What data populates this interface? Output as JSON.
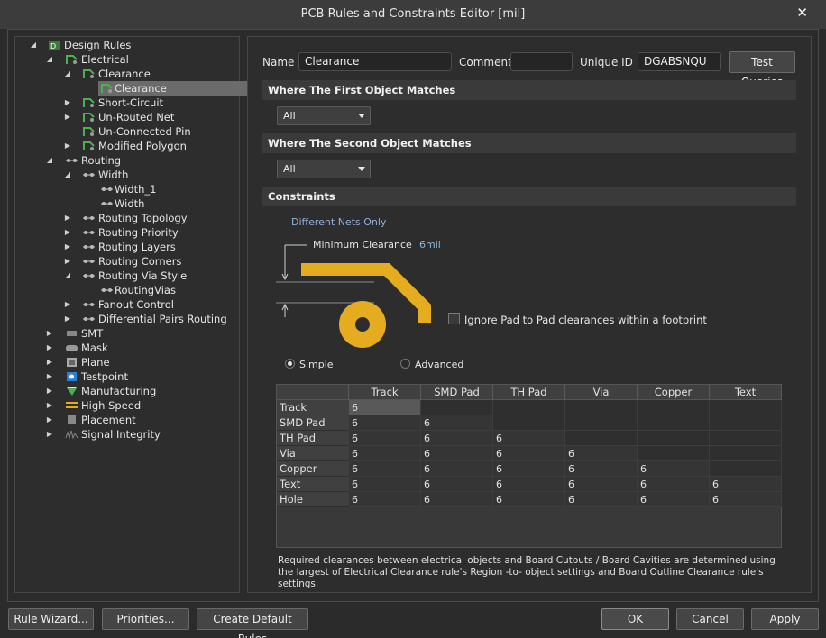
{
  "window": {
    "title": "PCB Rules and Constraints Editor [mil]"
  },
  "tree": [
    {
      "label": "Design Rules",
      "icon": "design-rules-icon",
      "arrow": "expanded",
      "level": 0
    },
    {
      "label": "Electrical",
      "icon": "electrical-icon",
      "arrow": "expanded",
      "level": 1
    },
    {
      "label": "Clearance",
      "icon": "clearance-rule-icon",
      "arrow": "expanded",
      "level": 2
    },
    {
      "label": "Clearance",
      "icon": "clearance-rule-icon",
      "arrow": "none",
      "level": 3,
      "selected": true
    },
    {
      "label": "Short-Circuit",
      "icon": "short-circuit-icon",
      "arrow": "collapsed",
      "level": 2
    },
    {
      "label": "Un-Routed Net",
      "icon": "unrouted-net-icon",
      "arrow": "collapsed",
      "level": 2
    },
    {
      "label": "Un-Connected Pin",
      "icon": "unconnected-pin-icon",
      "arrow": "none",
      "level": 2
    },
    {
      "label": "Modified Polygon",
      "icon": "modified-polygon-icon",
      "arrow": "collapsed",
      "level": 2
    },
    {
      "label": "Routing",
      "icon": "routing-icon",
      "arrow": "expanded",
      "level": 1
    },
    {
      "label": "Width",
      "icon": "width-rule-icon",
      "arrow": "expanded",
      "level": 2
    },
    {
      "label": "Width_1",
      "icon": "width-rule-icon",
      "arrow": "none",
      "level": 3
    },
    {
      "label": "Width",
      "icon": "width-rule-icon",
      "arrow": "none",
      "level": 3
    },
    {
      "label": "Routing Topology",
      "icon": "routing-topology-icon",
      "arrow": "collapsed",
      "level": 2
    },
    {
      "label": "Routing Priority",
      "icon": "routing-priority-icon",
      "arrow": "collapsed",
      "level": 2
    },
    {
      "label": "Routing Layers",
      "icon": "routing-layers-icon",
      "arrow": "collapsed",
      "level": 2
    },
    {
      "label": "Routing Corners",
      "icon": "routing-corners-icon",
      "arrow": "collapsed",
      "level": 2
    },
    {
      "label": "Routing Via Style",
      "icon": "routing-via-style-icon",
      "arrow": "expanded",
      "level": 2
    },
    {
      "label": "RoutingVias",
      "icon": "routing-via-style-icon",
      "arrow": "none",
      "level": 3
    },
    {
      "label": "Fanout Control",
      "icon": "fanout-control-icon",
      "arrow": "collapsed",
      "level": 2
    },
    {
      "label": "Differential Pairs Routing",
      "icon": "differential-pairs-icon",
      "arrow": "collapsed",
      "level": 2
    },
    {
      "label": "SMT",
      "icon": "smt-icon",
      "arrow": "collapsed",
      "level": 1
    },
    {
      "label": "Mask",
      "icon": "mask-icon",
      "arrow": "collapsed",
      "level": 1
    },
    {
      "label": "Plane",
      "icon": "plane-icon",
      "arrow": "collapsed",
      "level": 1
    },
    {
      "label": "Testpoint",
      "icon": "testpoint-icon",
      "arrow": "collapsed",
      "level": 1
    },
    {
      "label": "Manufacturing",
      "icon": "manufacturing-icon",
      "arrow": "collapsed",
      "level": 1
    },
    {
      "label": "High Speed",
      "icon": "high-speed-icon",
      "arrow": "collapsed",
      "level": 1
    },
    {
      "label": "Placement",
      "icon": "placement-icon",
      "arrow": "collapsed",
      "level": 1
    },
    {
      "label": "Signal Integrity",
      "icon": "signal-integrity-icon",
      "arrow": "collapsed",
      "level": 1
    }
  ],
  "header": {
    "name_label": "Name",
    "name_value": "Clearance",
    "comment_label": "Comment",
    "comment_value": "",
    "uid_label": "Unique ID",
    "uid_value": "DGABSNQU",
    "test_queries": "Test Queries"
  },
  "first_match": {
    "title": "Where The First Object Matches",
    "value": "All"
  },
  "second_match": {
    "title": "Where The Second Object Matches",
    "value": "All"
  },
  "constraints": {
    "title": "Constraints",
    "net_scope": "Different Nets Only",
    "min_clearance_label": "Minimum Clearance",
    "min_clearance_value": "6mil",
    "ignore_pad_label": "Ignore Pad to Pad clearances within a footprint",
    "ignore_pad_checked": false,
    "mode_simple": "Simple",
    "mode_advanced": "Advanced",
    "mode_selected": "simple"
  },
  "grid": {
    "columns": [
      "Track",
      "SMD Pad",
      "TH Pad",
      "Via",
      "Copper",
      "Text"
    ],
    "rows": [
      {
        "label": "Track",
        "values": [
          "6"
        ]
      },
      {
        "label": "SMD Pad",
        "values": [
          "6",
          "6"
        ]
      },
      {
        "label": "TH Pad",
        "values": [
          "6",
          "6",
          "6"
        ]
      },
      {
        "label": "Via",
        "values": [
          "6",
          "6",
          "6",
          "6"
        ]
      },
      {
        "label": "Copper",
        "values": [
          "6",
          "6",
          "6",
          "6",
          "6"
        ]
      },
      {
        "label": "Text",
        "values": [
          "6",
          "6",
          "6",
          "6",
          "6",
          "6"
        ]
      },
      {
        "label": "Hole",
        "values": [
          "6",
          "6",
          "6",
          "6",
          "6",
          "6"
        ]
      }
    ]
  },
  "note": "Required clearances between electrical objects and Board Cutouts / Board Cavities are determined using the largest of Electrical Clearance rule's Region -to- object settings and Board Outline Clearance rule's settings.",
  "footer": {
    "rule_wizard": "Rule Wizard...",
    "priorities": "Priorities...",
    "create_default": "Create Default Rules",
    "ok": "OK",
    "cancel": "Cancel",
    "apply": "Apply"
  },
  "colors": {
    "accent_copper": "#e4ac1e",
    "link_blue": "#8fb3d9",
    "selected_row": "#6b6b6b"
  }
}
